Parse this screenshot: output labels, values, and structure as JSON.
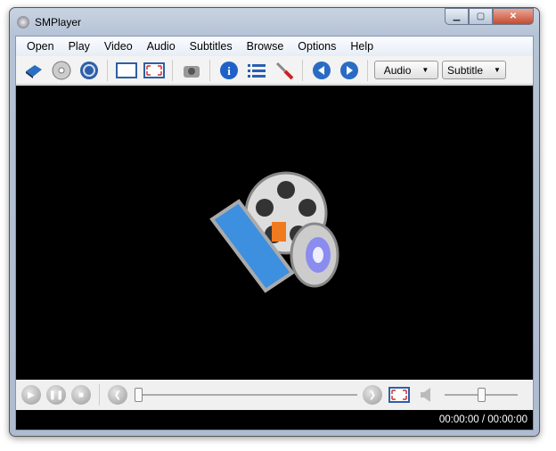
{
  "window": {
    "title": "SMPlayer"
  },
  "menu": [
    "Open",
    "Play",
    "Video",
    "Audio",
    "Subtitles",
    "Browse",
    "Options",
    "Help"
  ],
  "toolbar": {
    "audio_label": "Audio",
    "subtitle_label": "Subtitle"
  },
  "controls": {
    "seek_fraction": 0.0,
    "volume_fraction": 0.5
  },
  "status": {
    "time": "00:00:00 / 00:00:00"
  }
}
